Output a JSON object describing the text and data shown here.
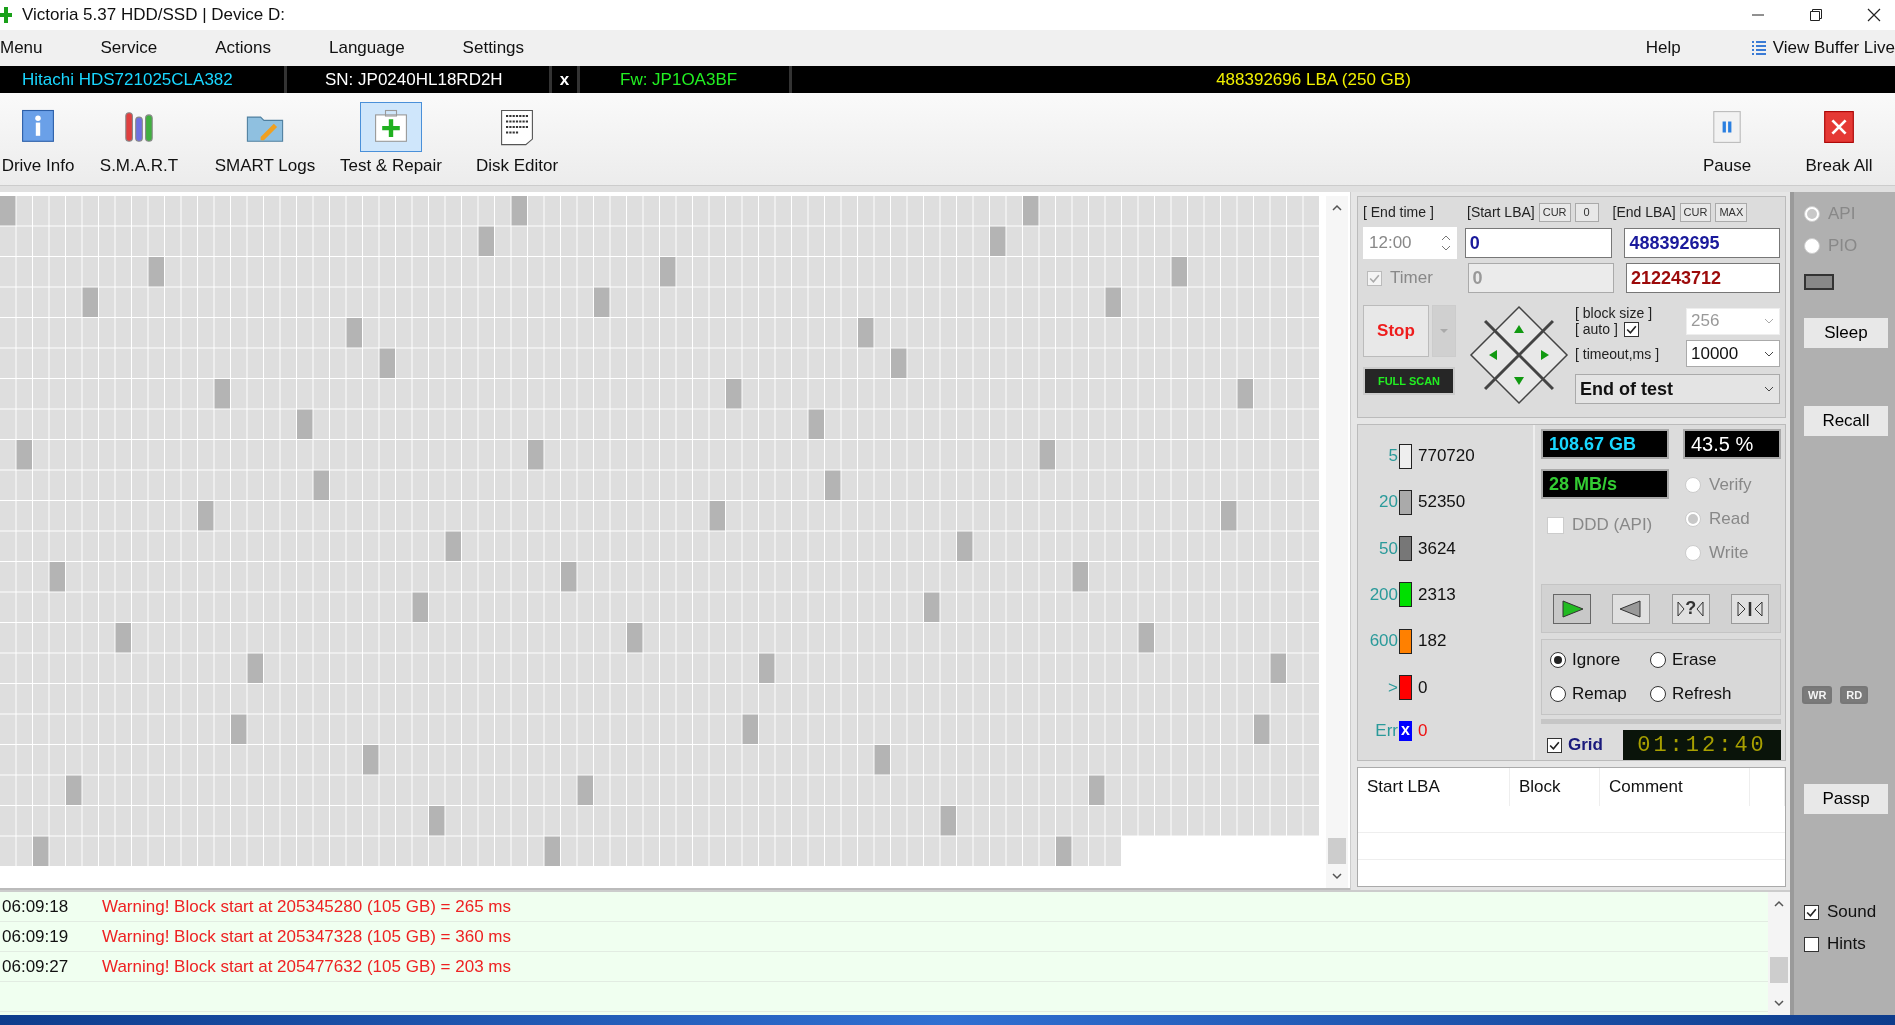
{
  "window": {
    "title": "Victoria 5.37 HDD/SSD | Device D:"
  },
  "menu": [
    {
      "label": "Menu"
    },
    {
      "label": "Service"
    },
    {
      "label": "Actions"
    },
    {
      "label": "Language"
    },
    {
      "label": "Settings"
    }
  ],
  "menu_right": {
    "help": "Help",
    "view_buffer": "View Buffer Live"
  },
  "drive_bar": {
    "model": "Hitachi HDS721025CLA382",
    "serial": "SN: JP0240HL18RD2H",
    "close": "x",
    "firmware": "Fw: JP1OA3BF",
    "capacity": "488392696 LBA (250 GB)"
  },
  "toolbar": [
    {
      "label": "Drive Info",
      "kind": "info",
      "selected": false
    },
    {
      "label": "S.M.A.R.T",
      "kind": "smart",
      "selected": false
    },
    {
      "label": "SMART Logs",
      "kind": "logs",
      "selected": false
    },
    {
      "label": "Test & Repair",
      "kind": "repair",
      "selected": true
    },
    {
      "label": "Disk Editor",
      "kind": "editor",
      "selected": false
    }
  ],
  "toolbar_right": [
    {
      "label": "Pause",
      "kind": "pause"
    },
    {
      "label": "Break All",
      "kind": "break"
    }
  ],
  "scan": {
    "end_time_label": "[ End time ]",
    "end_time": "12:00",
    "timer": {
      "label": "Timer",
      "checked": true
    },
    "start_lba_label": "[Start LBA]",
    "start_cur": "CUR",
    "start_zero": "0",
    "start_lba": "0",
    "start_lba_current": "0",
    "end_lba_label": "[End LBA]",
    "end_cur": "CUR",
    "end_max": "MAX",
    "end_lba": "488392695",
    "end_lba_current": "212243712",
    "stop": "Stop",
    "full_scan": "FULL SCAN",
    "block_size_label": "[ block size ]",
    "auto_label": "[ auto ]",
    "auto_checked": true,
    "block_size": "256",
    "timeout_label": "[ timeout,ms ]",
    "timeout": "10000",
    "end_action": "End of test"
  },
  "latency": [
    {
      "label": "5",
      "count": "770720",
      "color": "#eeeeee"
    },
    {
      "label": "20",
      "count": "52350",
      "color": "#aaaaaa"
    },
    {
      "label": "50",
      "count": "3624",
      "color": "#777777"
    },
    {
      "label": "200",
      "count": "2313",
      "color": "#00e000"
    },
    {
      "label": "600",
      "count": "182",
      "color": "#ff8000"
    },
    {
      "label": ">",
      "count": "0",
      "color": "#ff0000"
    },
    {
      "label": "Err",
      "count": "0",
      "color": "#0000ff",
      "symbol": "x",
      "kind": "error"
    }
  ],
  "progress": {
    "scanned": "108.67 GB",
    "percent": "43.5  %",
    "speed": "28 MB/s"
  },
  "ddd": {
    "label": "DDD (API)",
    "checked": false
  },
  "modes": [
    {
      "label": "Verify",
      "selected": false
    },
    {
      "label": "Read",
      "selected": true
    },
    {
      "label": "Write",
      "selected": false
    }
  ],
  "transport": [
    {
      "kind": "play",
      "selected": true
    },
    {
      "kind": "back",
      "selected": false
    },
    {
      "kind": "query",
      "symbol": "?",
      "selected": false
    },
    {
      "kind": "skip",
      "selected": false
    }
  ],
  "repair": [
    {
      "label": "Ignore",
      "selected": true
    },
    {
      "label": "Erase",
      "selected": false
    },
    {
      "label": "Remap",
      "selected": false
    },
    {
      "label": "Refresh",
      "selected": false
    }
  ],
  "grid_toggle": {
    "label": "Grid",
    "checked": true
  },
  "elapsed": "01:12:40",
  "table": {
    "columns": [
      "Start LBA",
      "Block",
      "Comment"
    ]
  },
  "side": {
    "interface": [
      {
        "label": "API",
        "selected": true
      },
      {
        "label": "PIO",
        "selected": false
      }
    ],
    "sleep": "Sleep",
    "recall": "Recall",
    "indicators": [
      "WR",
      "RD"
    ],
    "passp": "Passp"
  },
  "log": [
    {
      "time": "06:09:18",
      "message": "Warning! Block start at 205345280 (105 GB)  = 265 ms"
    },
    {
      "time": "06:09:19",
      "message": "Warning! Block start at 205347328 (105 GB)  = 360 ms"
    },
    {
      "time": "06:09:27",
      "message": "Warning! Block start at 205477632 (105 GB)  = 203 ms"
    }
  ],
  "options": [
    {
      "label": "Sound",
      "checked": true
    },
    {
      "label": "Hints",
      "checked": false
    }
  ]
}
